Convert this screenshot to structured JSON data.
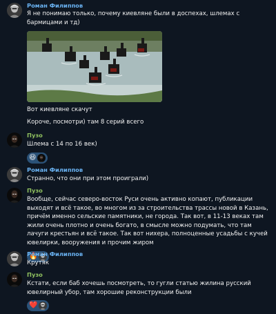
{
  "messages": {
    "m1": {
      "sender": "Роман Филиппов",
      "text": "Я не понимаю только, почему киевляне были в доспехах, шлемах с бармицами и тд)",
      "caption": "Вот киевляне скачут",
      "followup": "Короче, посмотри) там 8 серий всего"
    },
    "m2": {
      "sender": "Пузо",
      "text": "Шлема с 14 по 16 век)",
      "reaction_emoji": "😆"
    },
    "m3": {
      "sender": "Роман Филиппов",
      "text": "Странно, что они при этом проиграли)"
    },
    "m4": {
      "sender": "Пузо",
      "text": "Вообще, сейчас северо-восток Руси очень активно копают, публикации выходят и всё такое, во многом из за строительства трассы новой в Казань, причём именно сельские памятники, не города. Так вот, в 11-13 веках там жили очень плотно и очень богато, в смысле можно подумать, что там лачуги крестьян и всё такое. Так вот нихера, полноценные усадьбы с кучей ювелирки, вооружения и прочим жиром",
      "reaction_emoji": "🔥"
    },
    "m5": {
      "sender": "Роман Филиппов",
      "text": "Крутяк"
    },
    "m6": {
      "sender": "Пузо",
      "text": "Кстати, если баб хочешь посмотреть, то гугли статью жилина русский ювелирный убор, там хорошие реконструкции были",
      "reaction_emoji": "❤️"
    }
  },
  "colors": {
    "background": "#0e1621",
    "roman_name": "#6ab3f3",
    "puzo_name": "#8fc05f",
    "reaction_bg": "#2b5278",
    "text": "#f2f2f2"
  }
}
